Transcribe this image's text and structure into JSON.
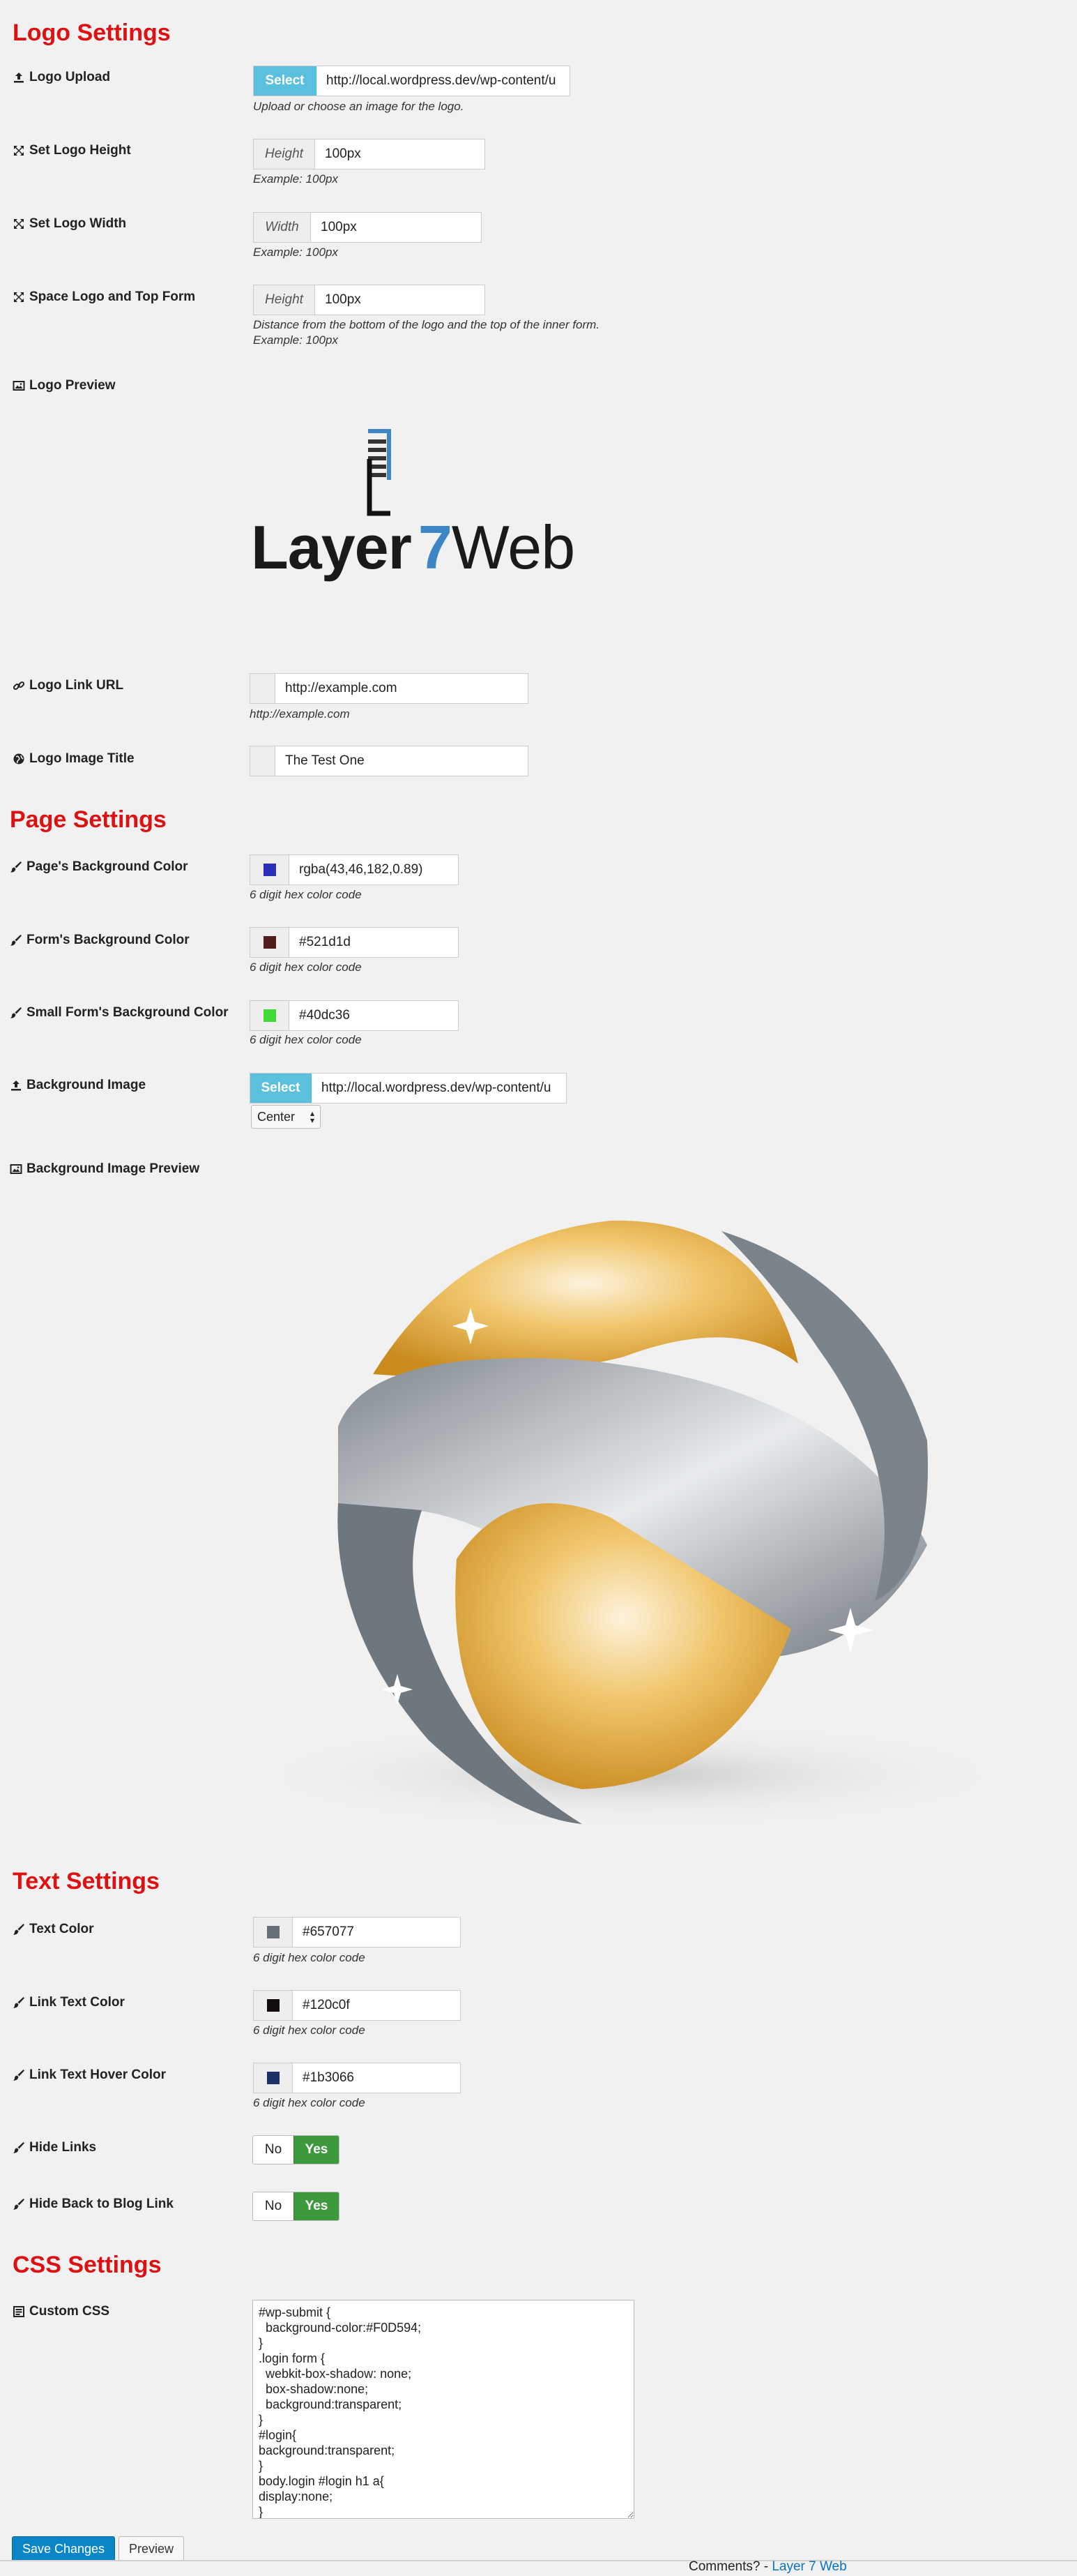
{
  "logo_settings": {
    "title": "Logo Settings",
    "logo_upload": {
      "label": "Logo Upload",
      "button": "Select",
      "value": "http://local.wordpress.dev/wp-content/u",
      "help": "Upload or choose an image for the logo."
    },
    "logo_height": {
      "label": "Set Logo Height",
      "addon": "Height",
      "value": "100px",
      "help": "Example: 100px"
    },
    "logo_width": {
      "label": "Set Logo Width",
      "addon": "Width",
      "value": "100px",
      "help": "Example: 100px"
    },
    "space_logo": {
      "label": "Space Logo and Top Form",
      "addon": "Height",
      "value": "100px",
      "help1": "Distance from the bottom of the logo and the top of the inner form.",
      "help2": "Example: 100px"
    },
    "logo_preview": {
      "label": "Logo Preview",
      "brand_word1": "Layer",
      "brand_word2": "7",
      "brand_word3": "Web"
    },
    "logo_link": {
      "label": "Logo Link URL",
      "value": "http://example.com",
      "help": "http://example.com"
    },
    "logo_title": {
      "label": "Logo Image Title",
      "value": "The Test One"
    }
  },
  "page_settings": {
    "title": "Page Settings",
    "page_bg": {
      "label": "Page's Background Color",
      "value": "rgba(43,46,182,0.89)",
      "swatch": "#2b2eb6",
      "help": "6 digit hex color code"
    },
    "form_bg": {
      "label": "Form's Background Color",
      "value": "#521d1d",
      "swatch": "#521d1d",
      "help": "6 digit hex color code"
    },
    "small_form_bg": {
      "label": "Small Form's Background Color",
      "value": "#40dc36",
      "swatch": "#40dc36",
      "help": "6 digit hex color code"
    },
    "bg_image": {
      "label": "Background Image",
      "button": "Select",
      "value": "http://local.wordpress.dev/wp-content/u",
      "position": "Center"
    },
    "bg_preview": {
      "label": "Background Image Preview"
    }
  },
  "text_settings": {
    "title": "Text Settings",
    "text_color": {
      "label": "Text Color",
      "value": "#657077",
      "swatch": "#657077",
      "help": "6 digit hex color code"
    },
    "link_color": {
      "label": "Link Text Color",
      "value": "#120c0f",
      "swatch": "#120c0f",
      "help": "6 digit hex color code"
    },
    "link_hover": {
      "label": "Link Text Hover Color",
      "value": "#1b3066",
      "swatch": "#1b3066",
      "help": "6 digit hex color code"
    },
    "hide_links": {
      "label": "Hide Links",
      "no": "No",
      "yes": "Yes"
    },
    "hide_back": {
      "label": "Hide Back to Blog Link",
      "no": "No",
      "yes": "Yes"
    }
  },
  "css_settings": {
    "title": "CSS Settings",
    "custom_css": {
      "label": "Custom CSS",
      "value": "#wp-submit {\n  background-color:#F0D594;\n}\n.login form {\n  webkit-box-shadow: none;\n  box-shadow:none;\n  background:transparent;\n}\n#login{\nbackground:transparent;\n}\nbody.login #login h1 a{\ndisplay:none;\n}"
    }
  },
  "actions": {
    "save": "Save Changes",
    "preview": "Preview"
  },
  "footer": {
    "text": "Comments? - ",
    "link": "Layer 7 Web"
  },
  "colors": {
    "heading": "#dd1111",
    "select_button": "#5bc0de",
    "toggle_on": "#3c9a3c",
    "save_button": "#0a86c7",
    "link": "#0a73c2"
  }
}
